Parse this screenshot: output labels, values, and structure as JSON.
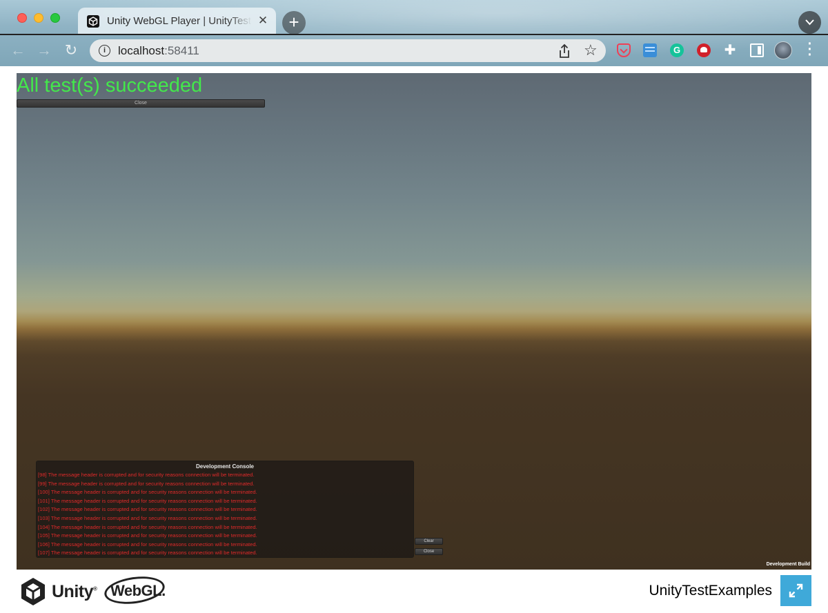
{
  "browser": {
    "tab_title": "Unity WebGL Player | UnityTestExamples",
    "tab_close": "✕",
    "new_tab": "+",
    "url_host": "localhost",
    "url_port": ":58411"
  },
  "game": {
    "status_text": "All test(s) succeeded",
    "close_label": "Close",
    "dev_build_label": "Development Build"
  },
  "console": {
    "title": "Development Console",
    "lines": [
      "[98] The message header is corrupted and for security reasons connection will be terminated.",
      "[99] The message header is corrupted and for security reasons connection will be terminated.",
      "[100] The message header is corrupted and for security reasons connection will be terminated.",
      "[101] The message header is corrupted and for security reasons connection will be terminated.",
      "[102] The message header is corrupted and for security reasons connection will be terminated.",
      "[103] The message header is corrupted and for security reasons connection will be terminated.",
      "[104] The message header is corrupted and for security reasons connection will be terminated.",
      "[105] The message header is corrupted and for security reasons connection will be terminated.",
      "[106] The message header is corrupted and for security reasons connection will be terminated.",
      "[107] The message header is corrupted and for security reasons connection will be terminated."
    ],
    "clear_label": "Clear",
    "close_label": "Close"
  },
  "footer": {
    "unity_label": "Unity",
    "unity_mark": "®",
    "webgl_label": "WebGL",
    "webgl_mark": ".",
    "product_name": "UnityTestExamples"
  },
  "colors": {
    "status_green": "#43e84b",
    "console_error_red": "#e02a2a",
    "fullscreen_blue": "#3fa9d9"
  },
  "icons": {
    "back": "arrow-left-icon",
    "forward": "arrow-right-icon",
    "reload": "reload-icon",
    "info": "info-icon",
    "share": "share-icon",
    "bookmark": "star-icon",
    "extensions": [
      "pocket-icon",
      "card-icon",
      "grammarly-icon",
      "red-extension-icon",
      "puzzle-icon",
      "side-panel-icon"
    ],
    "menu": "kebab-menu-icon",
    "fullscreen": "fullscreen-icon"
  }
}
